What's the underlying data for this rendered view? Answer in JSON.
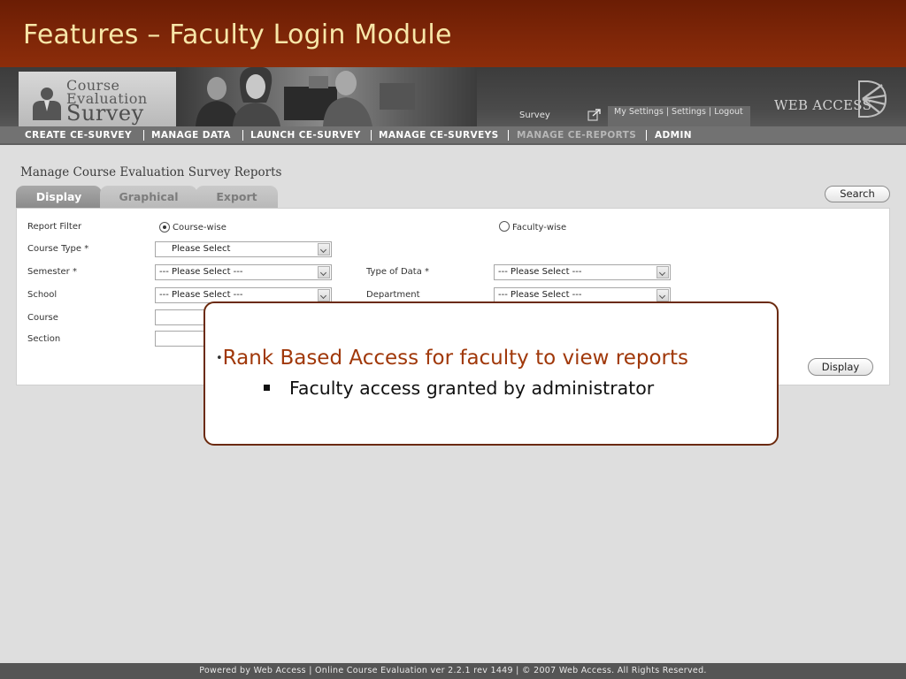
{
  "slide": {
    "title": "Features – Faculty Login Module"
  },
  "header": {
    "logo_line1": "Course",
    "logo_line2": "Evaluation",
    "logo_line3": "Survey",
    "survey_label": "Survey",
    "settings_text": "My Settings | Settings | Logout",
    "brand": "WEB ACCESS"
  },
  "nav": {
    "items": [
      {
        "label": "CREATE CE-SURVEY",
        "active": false
      },
      {
        "label": "MANAGE DATA",
        "active": false
      },
      {
        "label": "LAUNCH CE-SURVEY",
        "active": false
      },
      {
        "label": "MANAGE CE-SURVEYS",
        "active": false
      },
      {
        "label": "MANAGE CE-REPORTS",
        "active": true
      },
      {
        "label": "ADMIN",
        "active": false
      }
    ]
  },
  "page": {
    "heading": "Manage Course Evaluation Survey Reports",
    "tabs": [
      {
        "label": "Display",
        "selected": true
      },
      {
        "label": "Graphical",
        "selected": false
      },
      {
        "label": "Export",
        "selected": false
      }
    ],
    "search_label": "Search"
  },
  "form": {
    "report_filter_label": "Report Filter",
    "course_wise_label": "Course-wise",
    "faculty_wise_label": "Faculty-wise",
    "selected_filter": "course-wise",
    "course_type_label": "Course Type *",
    "course_type_value": "Please Select",
    "semester_label": "Semester *",
    "semester_value": "--- Please Select ---",
    "type_of_data_label": "Type of Data *",
    "type_of_data_value": "--- Please Select ---",
    "school_label": "School",
    "school_value": "--- Please Select ---",
    "department_label": "Department",
    "department_value": "--- Please Select ---",
    "course_label": "Course",
    "section_label": "Section",
    "display_button": "Display"
  },
  "callout": {
    "bullet_main": "Rank Based Access for faculty to view reports",
    "bullet_sub": "Faculty access granted by administrator",
    "main_color": "#a0380a"
  },
  "footer": {
    "text": "Powered by Web Access | Online Course Evaluation ver 2.2.1 rev 1449 | © 2007 Web Access. All Rights Reserved."
  }
}
